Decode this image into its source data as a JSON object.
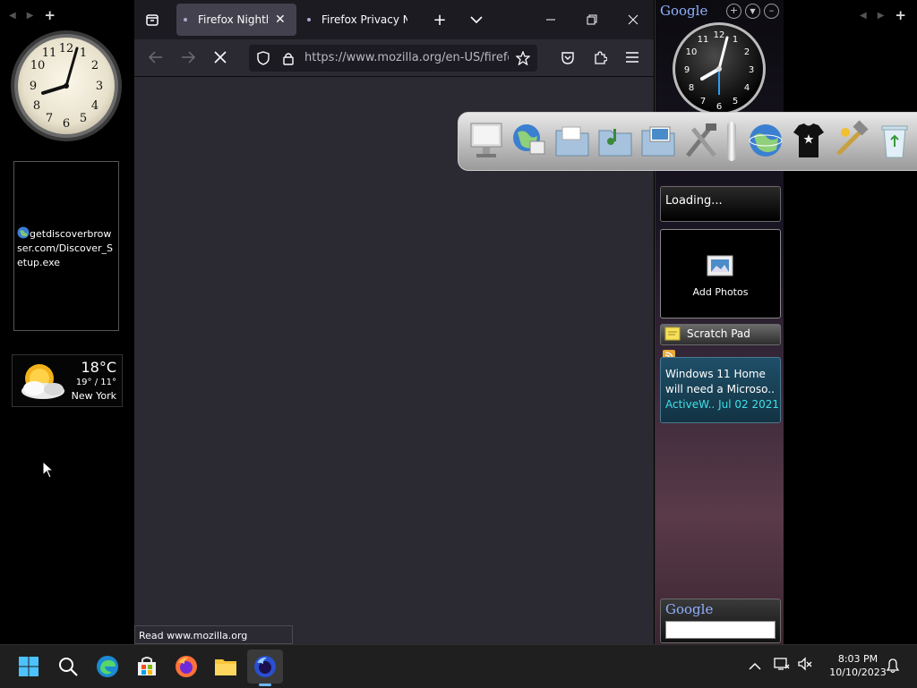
{
  "desktop": {
    "left_controls": {
      "plus": "+"
    },
    "right_controls": {
      "plus": "+"
    },
    "file_gadget": {
      "text": "getdiscoverbrowser.com/Discover_Setup.exe"
    },
    "weather": {
      "temp": "18°C",
      "range": "19° / 11°",
      "city": "New York"
    }
  },
  "firefox": {
    "tabs": [
      {
        "label": "Firefox Nightly",
        "active": true
      },
      {
        "label": "Firefox Privacy Ne",
        "active": false
      }
    ],
    "url": "https://www.mozilla.org/en-US/firefox",
    "status": "Read www.mozilla.org"
  },
  "sidebar": {
    "google_logo": "Google",
    "clock_numbers": [
      "12",
      "1",
      "2",
      "3",
      "4",
      "5",
      "6",
      "7",
      "8",
      "9",
      "10",
      "11"
    ],
    "loading": "Loading...",
    "photos": {
      "label": "Add Photos"
    },
    "scratch_pad": "Scratch Pad",
    "news": {
      "headline": "Windows 11 Home will need a Microso..",
      "source": "ActiveW..",
      "date": "Jul 02 2021"
    },
    "search_logo": "Google"
  },
  "taskbar": {
    "time": "8:03 PM",
    "date": "10/10/2023"
  },
  "colors": {
    "accent": "#0078d4",
    "ff_dark": "#1c1b22",
    "ff_page": "#2b2a33"
  }
}
